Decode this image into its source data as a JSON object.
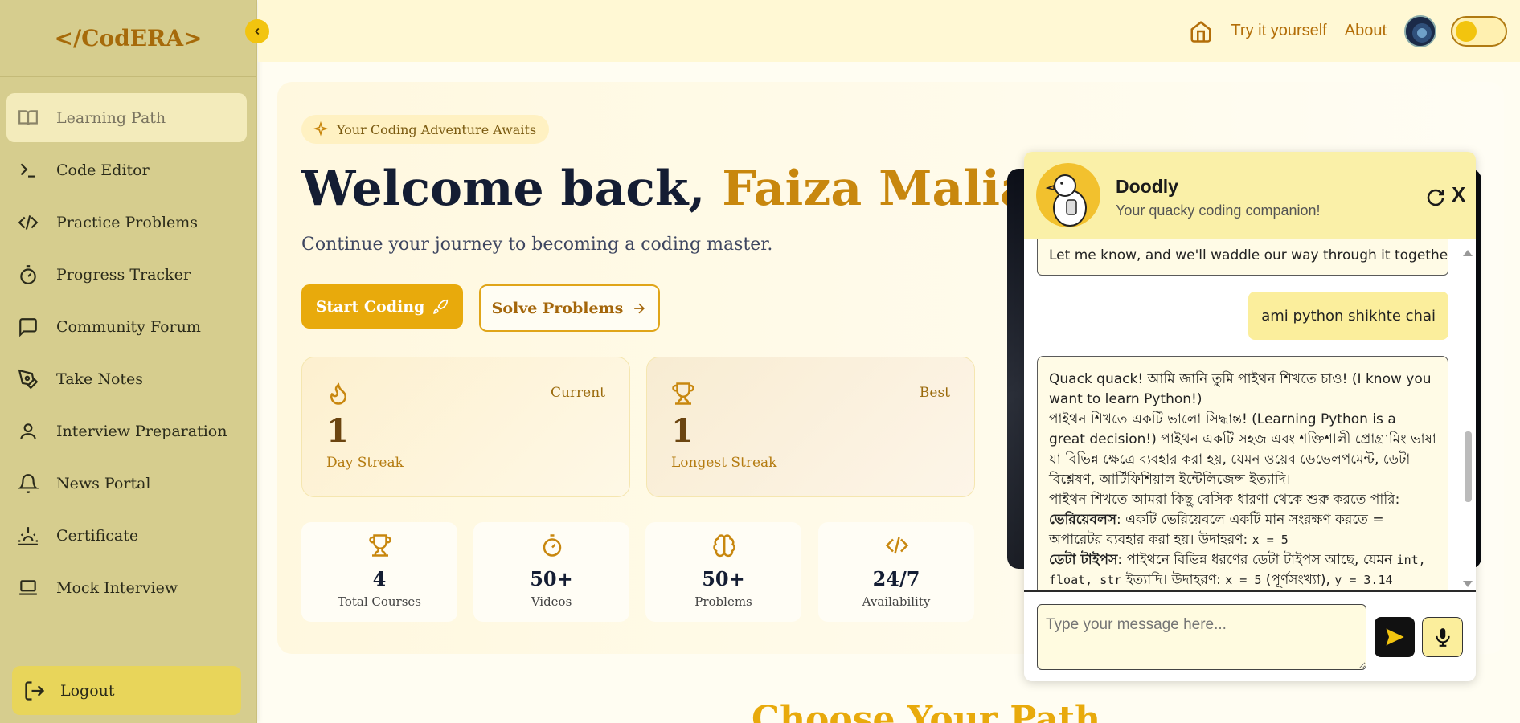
{
  "sidebar": {
    "brand": "</CodERA>",
    "items": [
      {
        "label": "Learning Path",
        "icon": "book-open-icon"
      },
      {
        "label": "Code Editor",
        "icon": "terminal-icon"
      },
      {
        "label": "Practice Problems",
        "icon": "code-icon"
      },
      {
        "label": "Progress Tracker",
        "icon": "timer-icon"
      },
      {
        "label": "Community Forum",
        "icon": "message-square-icon"
      },
      {
        "label": "Take Notes",
        "icon": "pen-tool-icon"
      },
      {
        "label": "Interview Preparation",
        "icon": "user-icon"
      },
      {
        "label": "News Portal",
        "icon": "bell-icon"
      },
      {
        "label": "Certificate",
        "icon": "sunrise-icon"
      },
      {
        "label": "Mock Interview",
        "icon": "laptop-icon"
      }
    ],
    "logout": "Logout"
  },
  "topbar": {
    "try": "Try it yourself",
    "about": "About"
  },
  "hero": {
    "chip": "Your Coding Adventure Awaits",
    "welcome_prefix": "Welcome back, ",
    "welcome_name": "Faiza Maliat!",
    "subtitle": "Continue your journey to becoming a coding master.",
    "start_btn": "Start Coding",
    "solve_btn": "Solve Problems"
  },
  "streaks": [
    {
      "tag": "Current",
      "value": "1",
      "label": "Day Streak"
    },
    {
      "tag": "Best",
      "value": "1",
      "label": "Longest Streak"
    }
  ],
  "stats": [
    {
      "value": "4",
      "label": "Total Courses"
    },
    {
      "value": "50+",
      "label": "Videos"
    },
    {
      "value": "50+",
      "label": "Problems"
    },
    {
      "value": "24/7",
      "label": "Availability"
    }
  ],
  "choose_heading": "Choose Your Path",
  "chat": {
    "title": "Doodly",
    "subtitle": "Your quacky coding companion!",
    "close": "X",
    "bot_msg_1": "Let me know, and we'll waddle our way through it together!",
    "user_msg_1": "ami python shikhte chai",
    "bot_msg_2": {
      "l1": "Quack quack! আমি জানি তুমি পাইথন শিখতে চাও! (I know you want to learn Python!)",
      "l2": "পাইথন শিখতে একটি ভালো সিদ্ধান্ত! (Learning Python is a great decision!) পাইথন একটি সহজ এবং শক্তিশালী প্রোগ্রামিং ভাষা যা বিভিন্ন ক্ষেত্রে ব্যবহার করা হয়, যেমন ওয়েব ডেভেলপমেন্ট, ডেটা বিশ্লেষণ, আর্টিফিশিয়াল ইন্টেলিজেন্স ইত্যাদি।",
      "l3": "পাইথন শিখতে আমরা কিছু বেসিক ধারণা থেকে শুরু করতে পারি:",
      "l4_bold": "ভেরিয়েবলস",
      "l4": ": একটি ভেরিয়েবলে একটি মান সংরক্ষণ করতে = অপারেটর ব্যবহার করা হয়। উদাহরণ: ",
      "l4_code": "x = 5",
      "l5_bold": "ডেটা টাইপস",
      "l5": ": পাইথনে বিভিন্ন ধরণের ডেটা টাইপস আছে, যেমন ",
      "l5_code": "int, float, str",
      "l5b": " ইত্যাদি। উদাহরণ: ",
      "l5_code2": "x = 5",
      "l5c": " (পূর্ণসংখ্যা), ",
      "l5_code3": "y = 3.14"
    },
    "placeholder": "Type your message here..."
  }
}
